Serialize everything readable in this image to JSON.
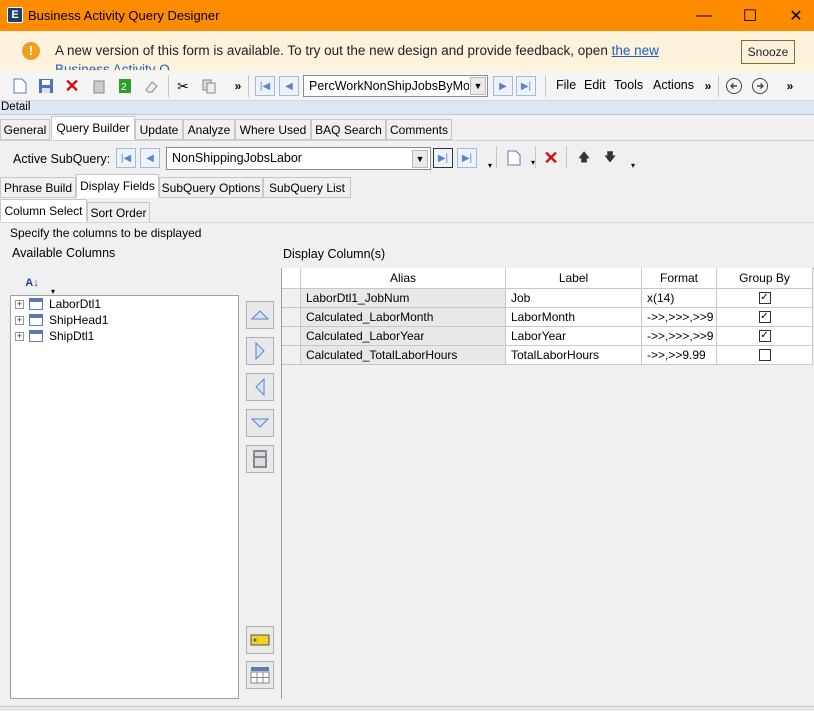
{
  "window": {
    "title": "Business Activity Query Designer",
    "controls": [
      "—",
      "☐",
      "✕"
    ]
  },
  "banner": {
    "message": "A new version of this form is available. To try out the new design and provide feedback, open",
    "link": "the new",
    "message_line2": "Business Activity Q...",
    "snooze": "Snooze"
  },
  "toolbar": {
    "query_name": "PercWorkNonShipJobsByMon",
    "menus": [
      "File",
      "Edit",
      "Tools",
      "Actions"
    ]
  },
  "detail": {
    "label": "Detail"
  },
  "main_tabs": [
    "General",
    "Query Builder",
    "Update",
    "Analyze",
    "Where Used",
    "BAQ Search",
    "Comments"
  ],
  "subquery": {
    "label": "Active SubQuery:",
    "value": "NonShippingJobsLabor"
  },
  "sub_tabs": [
    "Phrase Build",
    "Display Fields",
    "SubQuery Options",
    "SubQuery List"
  ],
  "inner_tabs": [
    "Column Select",
    "Sort Order"
  ],
  "instructions": "Specify the columns to be displayed",
  "available": {
    "label": "Available Columns",
    "tables": [
      "LaborDtl1",
      "ShipHead1",
      "ShipDtl1"
    ]
  },
  "display": {
    "label": "Display Column(s)",
    "columns": [
      "Alias",
      "Label",
      "Format",
      "Group By"
    ],
    "rows": [
      {
        "alias": "LaborDtl1_JobNum",
        "label": "Job",
        "format": "x(14)",
        "group_by": true
      },
      {
        "alias": "Calculated_LaborMonth",
        "label": "LaborMonth",
        "format": "->>,>>>,>>9",
        "group_by": true
      },
      {
        "alias": "Calculated_LaborYear",
        "label": "LaborYear",
        "format": "->>,>>>,>>9",
        "group_by": true
      },
      {
        "alias": "Calculated_TotalLaborHours",
        "label": "TotalLaborHours",
        "format": "->>,>>9.99",
        "group_by": false
      }
    ]
  },
  "colors": {
    "titlebar": "#ff8c00",
    "banner": "#fdf2dc",
    "link": "#1a60c0"
  }
}
